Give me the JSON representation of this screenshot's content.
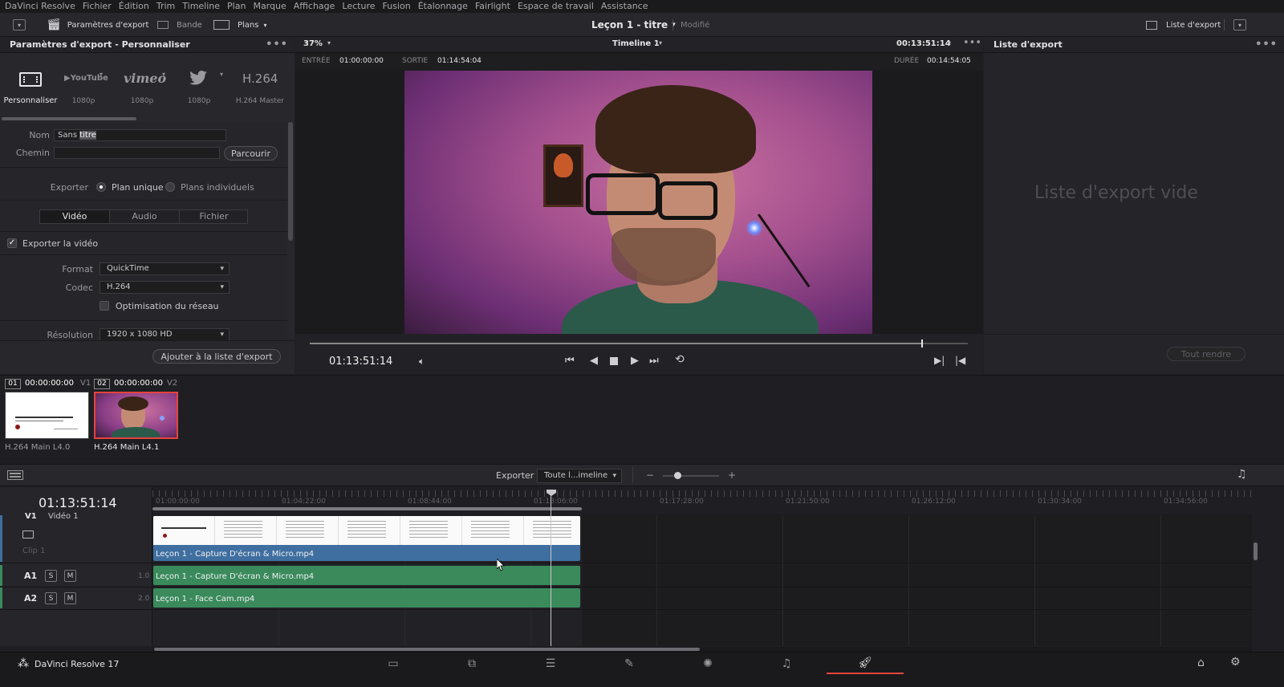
{
  "menu": [
    "DaVinci Resolve",
    "Fichier",
    "Édition",
    "Trim",
    "Timeline",
    "Plan",
    "Marque",
    "Affichage",
    "Lecture",
    "Fusion",
    "Étalonnage",
    "Fairlight",
    "Espace de travail",
    "Assistance"
  ],
  "toolbar": {
    "export_settings": "Paramètres d'export",
    "tape": "Bande",
    "clips": "Plans",
    "project_title": "Leçon 1 - titre",
    "modified": "Modifié",
    "render_queue": "Liste d'export"
  },
  "settings": {
    "header": "Paramètres d'export - Personnaliser",
    "presets": [
      {
        "name": "Personnaliser",
        "icon": "film-icon",
        "caption": ""
      },
      {
        "name": "YouTube",
        "icon": "youtube-logo",
        "caption": "1080p"
      },
      {
        "name": "vimeo",
        "icon": "vimeo-logo",
        "caption": "1080p"
      },
      {
        "name": "Twitter",
        "icon": "twitter-icon",
        "caption": "1080p"
      },
      {
        "name": "H.264",
        "icon": "h264-text",
        "caption": "H.264 Master"
      }
    ],
    "name_label": "Nom",
    "name_value_plain": "Sans ",
    "name_value_selected": "titre",
    "path_label": "Chemin",
    "path_value": "",
    "browse": "Parcourir",
    "export_label": "Exporter",
    "single_clip": "Plan unique",
    "individual_clips": "Plans individuels",
    "tabs": [
      "Vidéo",
      "Audio",
      "Fichier"
    ],
    "active_tab": "Vidéo",
    "export_video": "Exporter la vidéo",
    "format_label": "Format",
    "format_value": "QuickTime",
    "codec_label": "Codec",
    "codec_value": "H.264",
    "network_opt": "Optimisation du réseau",
    "resolution_label": "Résolution",
    "resolution_value": "1920 x 1080 HD",
    "add_to_queue": "Ajouter à la liste d'export"
  },
  "viewer": {
    "zoom": "37%",
    "timeline_name": "Timeline 1",
    "timecode_top": "00:13:51:14",
    "in_label": "ENTRÉE",
    "in_value": "01:00:00:00",
    "out_label": "SORTIE",
    "out_value": "01:14:54:04",
    "duration_label": "DURÉE",
    "duration_value": "00:14:54:05",
    "current_tc": "01:13:51:14",
    "scrub_progress": 0.93
  },
  "queue": {
    "header": "Liste d'export",
    "empty": "Liste d'export vide",
    "render_all": "Tout rendre"
  },
  "clips": [
    {
      "index": "01",
      "tc": "00:00:00:00",
      "track": "V1",
      "codec": "H.264 Main L4.0"
    },
    {
      "index": "02",
      "tc": "00:00:00:00",
      "track": "V2",
      "codec": "H.264 Main L4.1"
    }
  ],
  "timeline": {
    "export_label": "Exporter",
    "export_range": "Toute l...imeline",
    "timecode": "01:13:51:14",
    "ruler": [
      "01:00:00:00",
      "01:04:22:00",
      "01:08:44:00",
      "01:13:06:00",
      "01:17:28:00",
      "01:21:50:00",
      "01:26:12:00",
      "01:30:34:00",
      "01:34:56:00"
    ],
    "v1_label": "V1",
    "v1_name": "Vidéo 1",
    "clip1_label": "Clip 1",
    "video_clip": "Leçon 1 - Capture D'écran & Micro.mp4",
    "a1_label": "A1",
    "a1_level": "1.0",
    "a1_clip": "Leçon 1 - Capture D'écran & Micro.mp4",
    "a2_label": "A2",
    "a2_level": "2.0",
    "a2_clip": "Leçon 1 - Face Cam.mp4",
    "solo": "S",
    "mute": "M"
  },
  "footer": {
    "app_name": "DaVinci Resolve 17"
  },
  "colors": {
    "video_clip": "#3f6fa0",
    "audio_clip": "#3a8a5c",
    "accent_red": "#e5433c"
  }
}
